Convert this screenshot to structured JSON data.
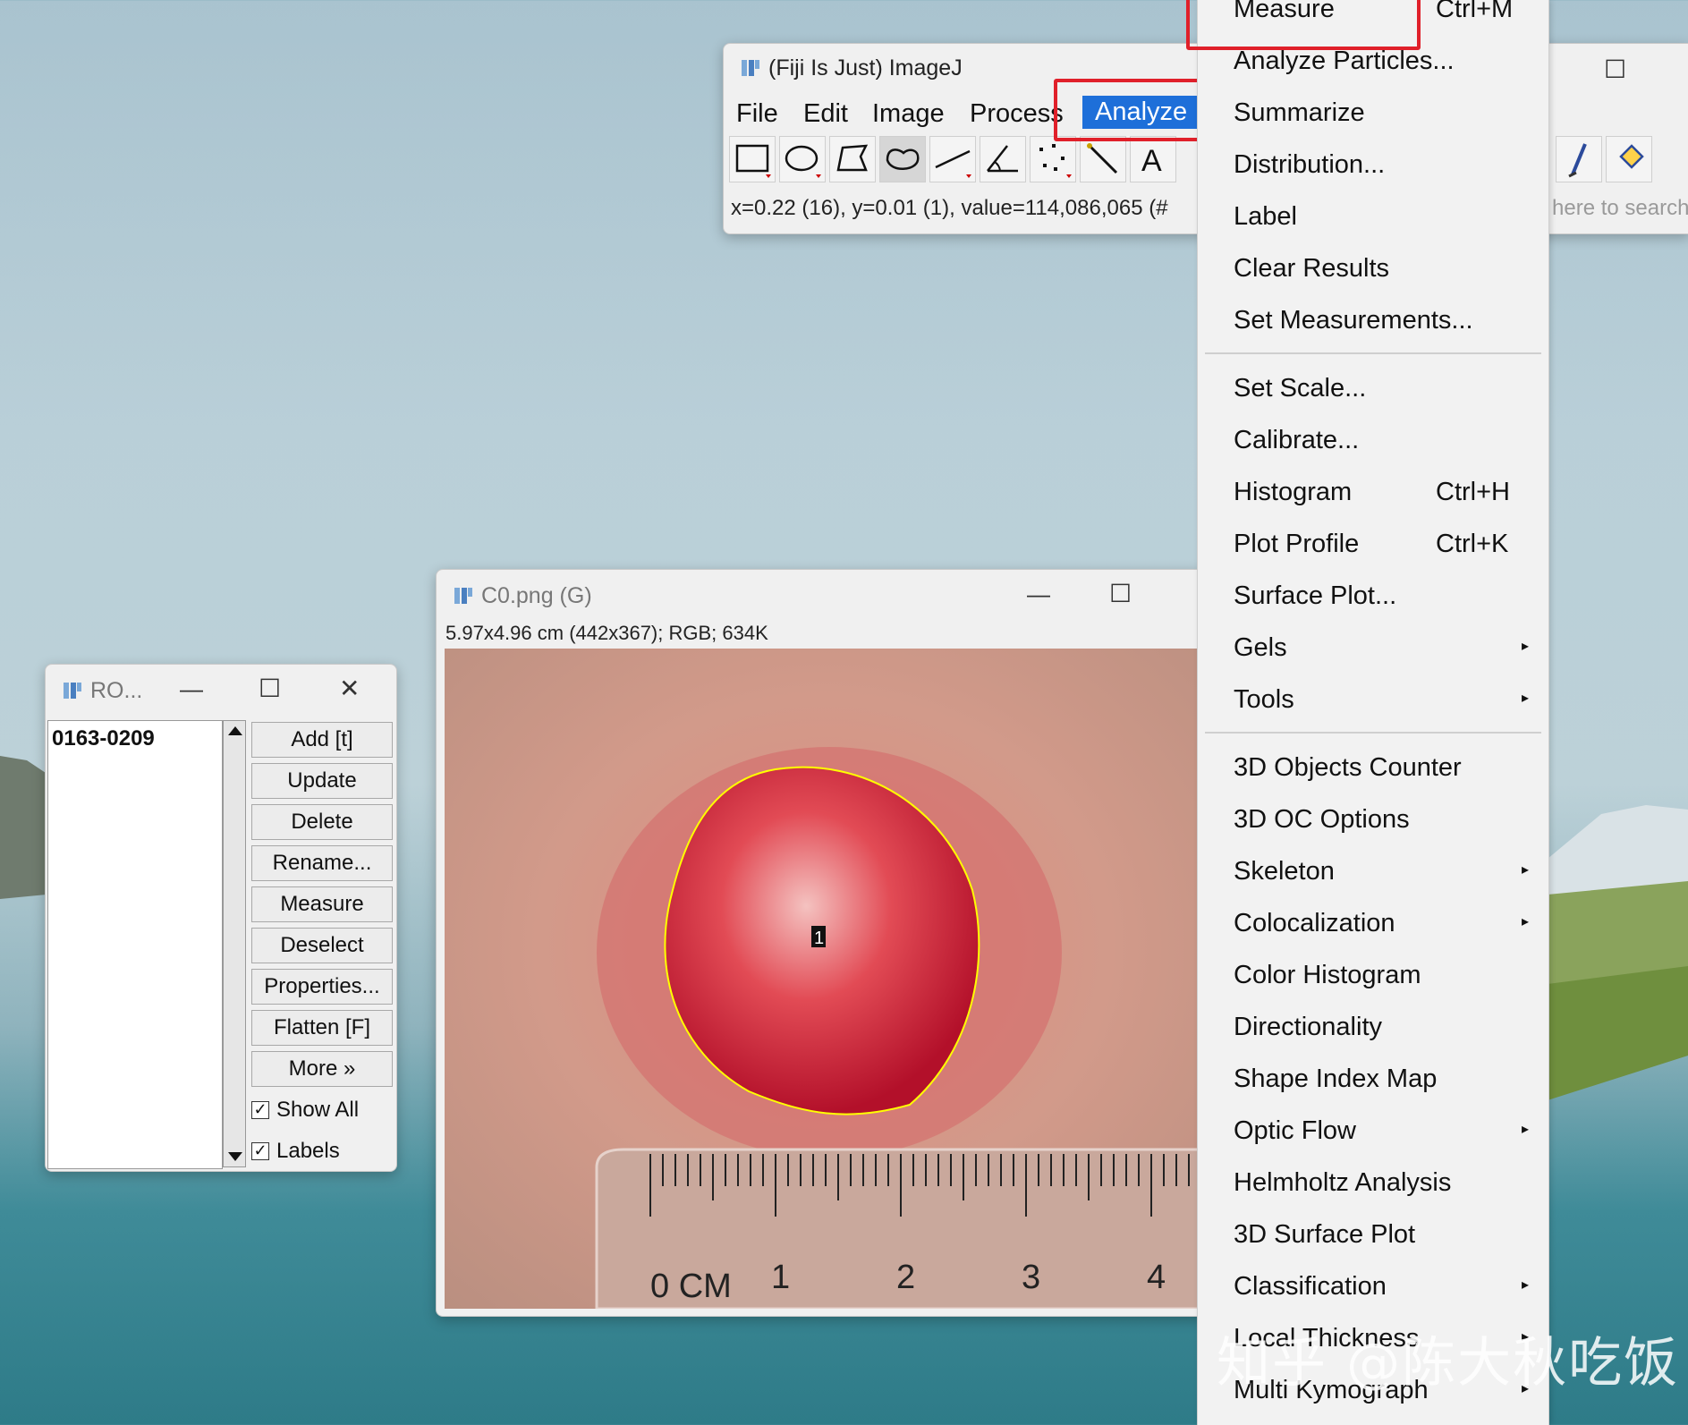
{
  "imagej_main": {
    "title": "(Fiji Is Just) ImageJ",
    "menus": [
      "File",
      "Edit",
      "Image",
      "Process",
      "Analyze"
    ],
    "active_menu": "Analyze",
    "status": "x=0.22 (16), y=0.01 (1), value=114,086,065 (#",
    "search_placeholder": "here to search",
    "tools": [
      "rectangle-tool-icon",
      "oval-tool-icon",
      "polygon-tool-icon",
      "freehand-tool-icon",
      "line-tool-icon",
      "angle-tool-icon",
      "multipoint-tool-icon",
      "wand-tool-icon",
      "text-tool-icon"
    ]
  },
  "analyze_menu": {
    "items": [
      {
        "label": "Measure",
        "shortcut": "Ctrl+M"
      },
      {
        "label": "Analyze Particles...",
        "shortcut": ""
      },
      {
        "label": "Summarize",
        "shortcut": ""
      },
      {
        "label": "Distribution...",
        "shortcut": ""
      },
      {
        "label": "Label",
        "shortcut": ""
      },
      {
        "label": "Clear Results",
        "shortcut": ""
      },
      {
        "label": "Set Measurements...",
        "shortcut": ""
      },
      {
        "label": "Set Scale...",
        "shortcut": ""
      },
      {
        "label": "Calibrate...",
        "shortcut": ""
      },
      {
        "label": "Histogram",
        "shortcut": "Ctrl+H"
      },
      {
        "label": "Plot Profile",
        "shortcut": "Ctrl+K"
      },
      {
        "label": "Surface Plot...",
        "shortcut": ""
      },
      {
        "label": "Gels",
        "shortcut": ""
      },
      {
        "label": "Tools",
        "shortcut": ""
      },
      {
        "label": "3D Objects Counter",
        "shortcut": ""
      },
      {
        "label": "3D OC Options",
        "shortcut": ""
      },
      {
        "label": "Skeleton",
        "shortcut": ""
      },
      {
        "label": "Colocalization",
        "shortcut": ""
      },
      {
        "label": "Color Histogram",
        "shortcut": ""
      },
      {
        "label": "Directionality",
        "shortcut": ""
      },
      {
        "label": "Shape Index Map",
        "shortcut": ""
      },
      {
        "label": "Optic Flow",
        "shortcut": ""
      },
      {
        "label": "Helmholtz Analysis",
        "shortcut": ""
      },
      {
        "label": "3D Surface Plot",
        "shortcut": ""
      },
      {
        "label": "Classification",
        "shortcut": ""
      },
      {
        "label": "Local Thickness",
        "shortcut": ""
      },
      {
        "label": "Multi Kymograph",
        "shortcut": ""
      }
    ],
    "submenu_arrow": "▸"
  },
  "image_window": {
    "title": "C0.png (G)",
    "info": "5.97x4.96 cm (442x367); RGB; 634K",
    "roi_label": "1",
    "ruler_labels": [
      "0 CM",
      "1",
      "2",
      "3",
      "4"
    ]
  },
  "roi_manager": {
    "title": "RO...",
    "list_items": [
      "0163-0209"
    ],
    "buttons": [
      "Add [t]",
      "Update",
      "Delete",
      "Rename...",
      "Measure",
      "Deselect",
      "Properties...",
      "Flatten [F]",
      "More »"
    ],
    "checkboxes": [
      {
        "label": "Show All",
        "checked": true
      },
      {
        "label": "Labels",
        "checked": true
      }
    ]
  },
  "window_controls": {
    "minimize": "—",
    "maximize": "☐",
    "close": "✕"
  },
  "watermark": "知乎 @陈大秋吃饭",
  "colors": {
    "highlight": "#1e6fd9",
    "annotation_red": "#e0202a",
    "roi_yellow": "#ffff00"
  }
}
